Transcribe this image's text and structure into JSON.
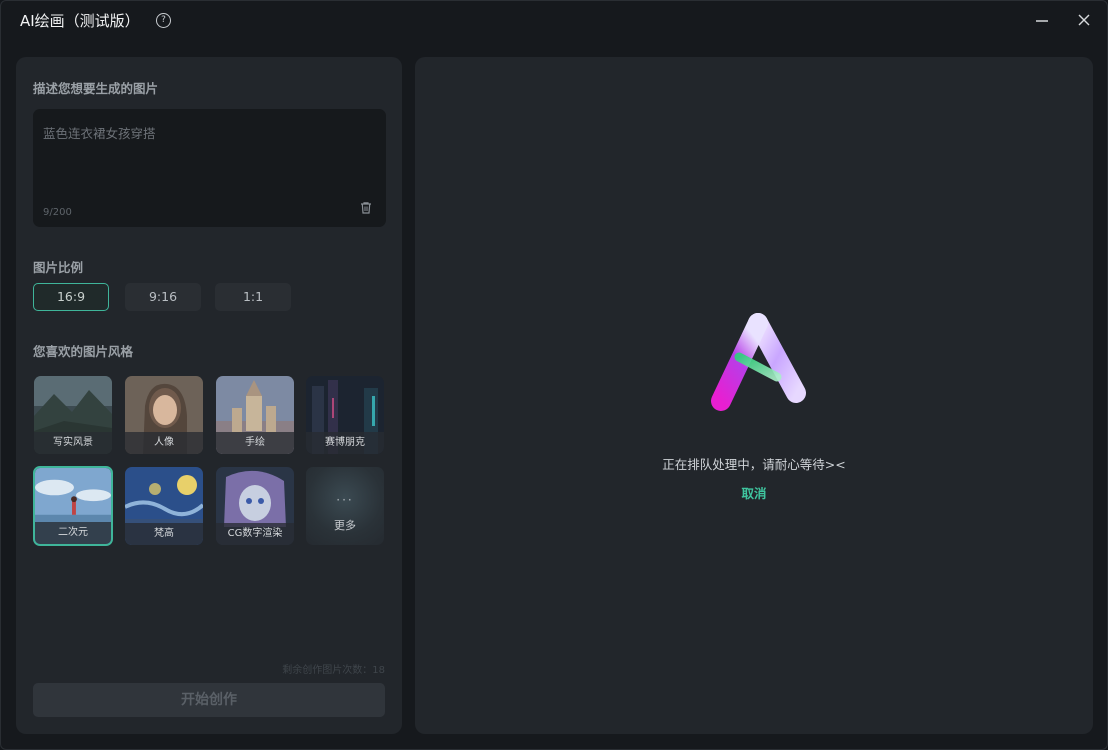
{
  "window": {
    "title": "AI绘画（测试版）",
    "help_icon_glyph": "?",
    "controls": {
      "minimize": "minimize-icon",
      "close": "close-icon"
    }
  },
  "left_panel": {
    "describe_label": "描述您想要生成的图片",
    "prompt": {
      "value": "蓝色连衣裙女孩穿搭",
      "char_count": "9/200"
    },
    "ratio_label": "图片比例",
    "ratios": [
      {
        "label": "16:9",
        "selected": true
      },
      {
        "label": "9:16",
        "selected": false
      },
      {
        "label": "1:1",
        "selected": false
      }
    ],
    "style_label": "您喜欢的图片风格",
    "styles": [
      {
        "label": "写实风景",
        "selected": false
      },
      {
        "label": "人像",
        "selected": false
      },
      {
        "label": "手绘",
        "selected": false
      },
      {
        "label": "赛博朋克",
        "selected": false
      },
      {
        "label": "二次元",
        "selected": true
      },
      {
        "label": "梵高",
        "selected": false
      },
      {
        "label": "CG数字渲染",
        "selected": false
      },
      {
        "label": "更多",
        "selected": false,
        "glyph": "···"
      }
    ],
    "remaining_text": "剩余创作图片次数：18",
    "start_button": "开始创作"
  },
  "right_panel": {
    "status": "正在排队处理中，请耐心等待><",
    "cancel": "取消"
  },
  "colors": {
    "accent": "#3fc59f",
    "panel": "#22262b",
    "background": "#16191d"
  }
}
